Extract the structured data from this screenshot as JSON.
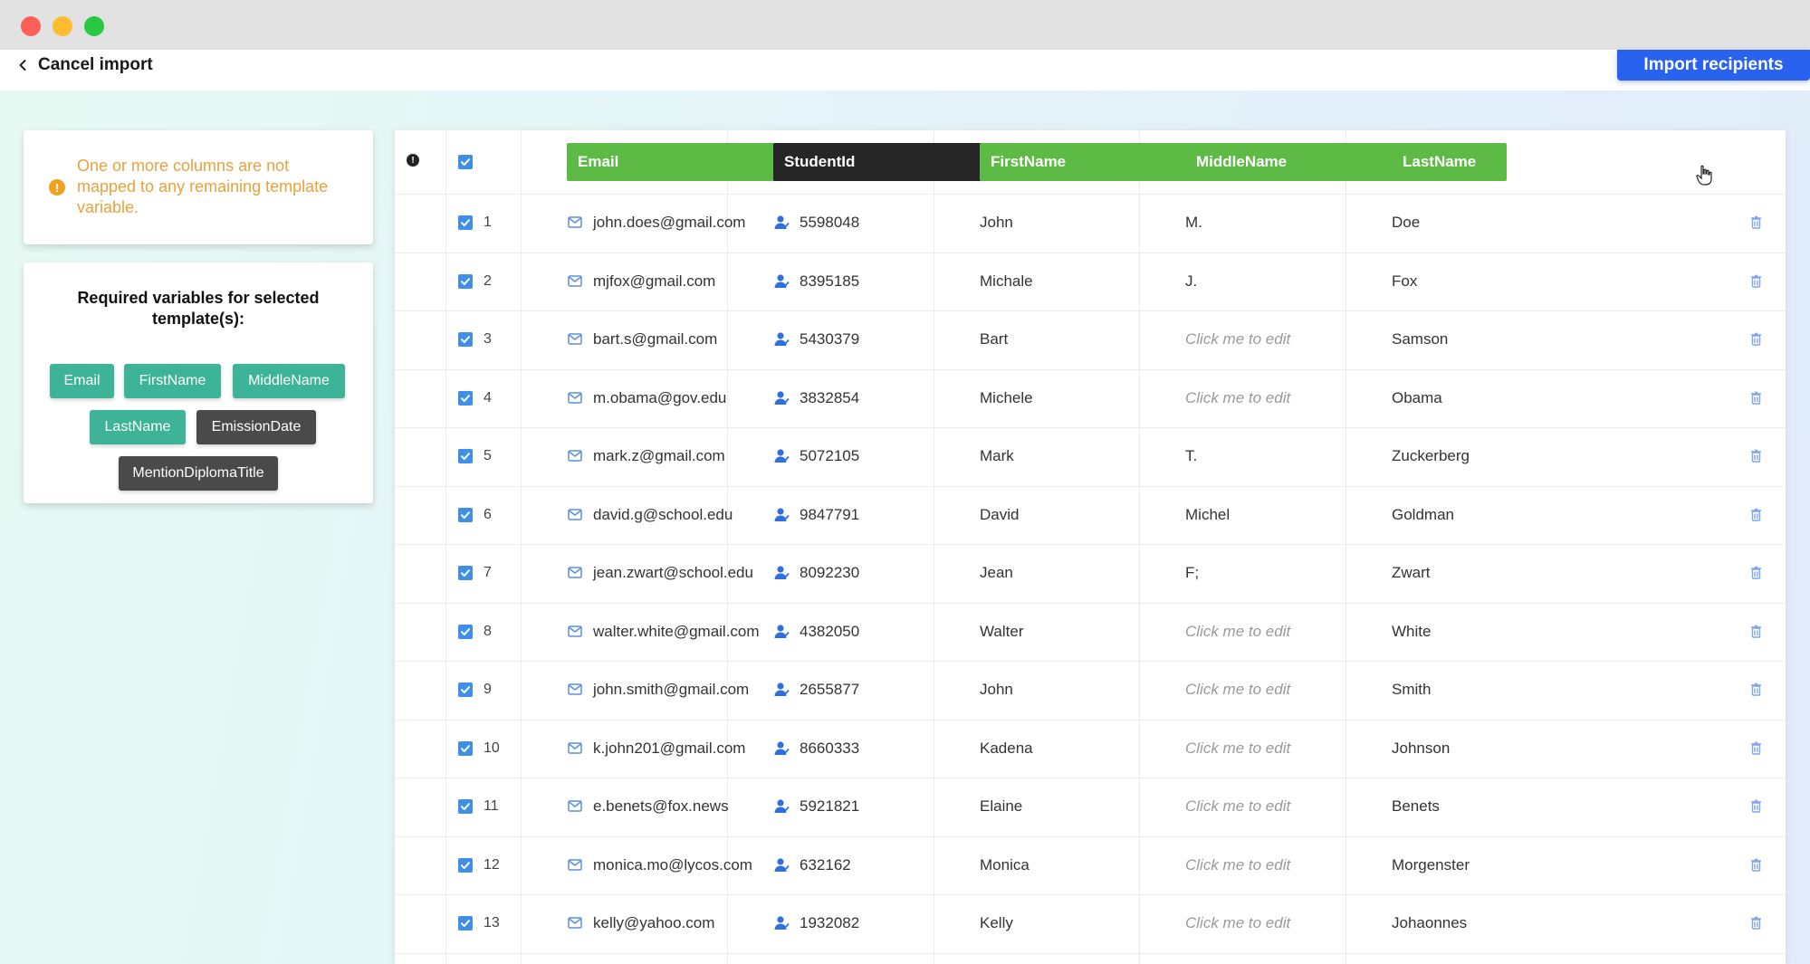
{
  "topbar": {
    "cancel_label": "Cancel import",
    "import_label": "Import recipients"
  },
  "warning": {
    "text": "One or more columns are not mapped to any remaining template variable."
  },
  "required": {
    "title": "Required variables for selected template(s):",
    "chips": [
      {
        "label": "Email",
        "style": "teal"
      },
      {
        "label": "FirstName",
        "style": "teal"
      },
      {
        "label": "MiddleName",
        "style": "teal"
      },
      {
        "label": "LastName",
        "style": "teal"
      },
      {
        "label": "EmissionDate",
        "style": "dark"
      },
      {
        "label": "MentionDiplomaTitle",
        "style": "dark"
      }
    ]
  },
  "table": {
    "columns": [
      {
        "label": "Email",
        "color": "#5dbb45"
      },
      {
        "label": "StudentId",
        "color": "#262626"
      },
      {
        "label": "FirstName",
        "color": "#5dbb45"
      },
      {
        "label": "MiddleName",
        "color": "#5dbb45"
      },
      {
        "label": "LastName",
        "color": "#5dbb45"
      }
    ],
    "placeholder": "Click me to edit",
    "rows": [
      {
        "num": "1",
        "email": "john.does@gmail.com",
        "id": "5598048",
        "first": "John",
        "middle": "M.",
        "last": "Doe"
      },
      {
        "num": "2",
        "email": "mjfox@gmail.com",
        "id": "8395185",
        "first": "Michale",
        "middle": "J.",
        "last": "Fox"
      },
      {
        "num": "3",
        "email": "bart.s@gmail.com",
        "id": "5430379",
        "first": "Bart",
        "middle": "",
        "last": "Samson"
      },
      {
        "num": "4",
        "email": "m.obama@gov.edu",
        "id": "3832854",
        "first": "Michele",
        "middle": "",
        "last": "Obama"
      },
      {
        "num": "5",
        "email": "mark.z@gmail.com",
        "id": "5072105",
        "first": "Mark",
        "middle": "T.",
        "last": "Zuckerberg"
      },
      {
        "num": "6",
        "email": "david.g@school.edu",
        "id": "9847791",
        "first": "David",
        "middle": "Michel",
        "last": "Goldman"
      },
      {
        "num": "7",
        "email": "jean.zwart@school.edu",
        "id": "8092230",
        "first": "Jean",
        "middle": "F;",
        "last": "Zwart"
      },
      {
        "num": "8",
        "email": "walter.white@gmail.com",
        "id": "4382050",
        "first": "Walter",
        "middle": "",
        "last": "White"
      },
      {
        "num": "9",
        "email": "john.smith@gmail.com",
        "id": "2655877",
        "first": "John",
        "middle": "",
        "last": "Smith"
      },
      {
        "num": "10",
        "email": "k.john201@gmail.com",
        "id": "8660333",
        "first": "Kadena",
        "middle": "",
        "last": "Johnson"
      },
      {
        "num": "11",
        "email": "e.benets@fox.news",
        "id": "5921821",
        "first": "Elaine",
        "middle": "",
        "last": "Benets"
      },
      {
        "num": "12",
        "email": "monica.mo@lycos.com",
        "id": "632162",
        "first": "Monica",
        "middle": "",
        "last": "Morgenster"
      },
      {
        "num": "13",
        "email": "kelly@yahoo.com",
        "id": "1932082",
        "first": "Kelly",
        "middle": "",
        "last": "Johaonnes"
      }
    ]
  },
  "colors": {
    "accent_blue": "#2a62f0",
    "warning_orange": "#e9a23b",
    "chip_teal": "#3db497",
    "chip_dark": "#4a4a4a",
    "checkbox_blue": "#3f8fe6"
  },
  "icons": [
    "chevron-left-icon",
    "warning-icon",
    "info-icon",
    "check-icon",
    "chevron-down-icon",
    "mail-icon",
    "person-icon",
    "trash-icon",
    "pointer-cursor-icon"
  ]
}
